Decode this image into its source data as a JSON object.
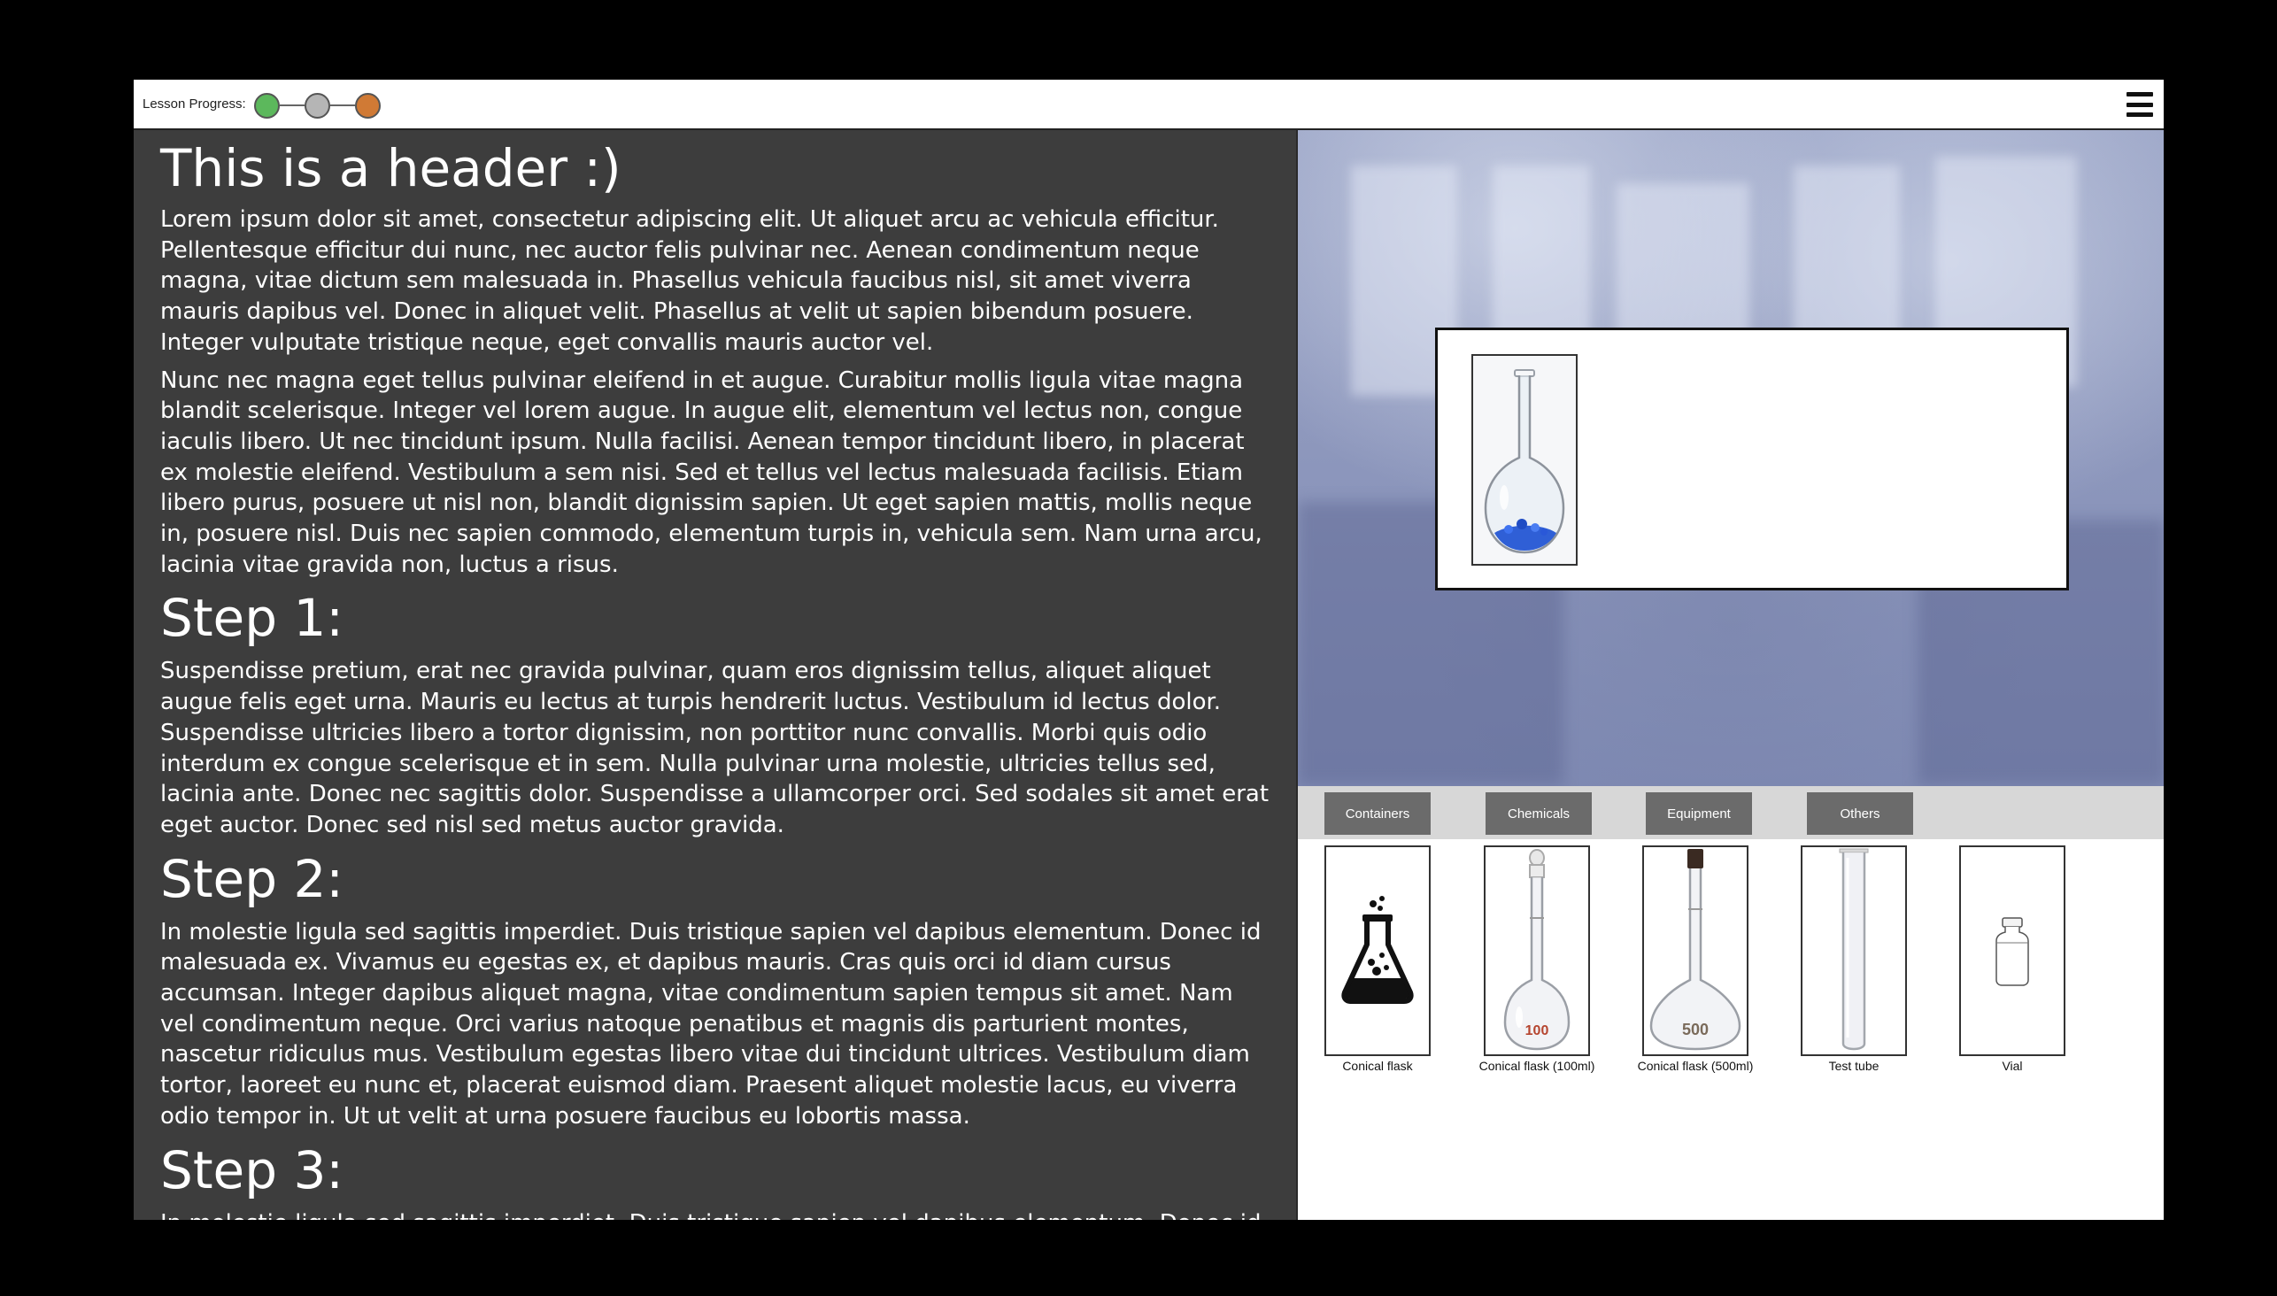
{
  "topbar": {
    "progress_label": "Lesson Progress:",
    "progress_steps": [
      {
        "state": "complete",
        "color": "#5cb85c"
      },
      {
        "state": "pending",
        "color": "#b5b5b5"
      },
      {
        "state": "current",
        "color": "#d07a35"
      }
    ],
    "menu_icon": "hamburger-menu-icon"
  },
  "content": {
    "header": "This is a header :)",
    "intro_p1": "Lorem ipsum dolor sit amet, consectetur adipiscing elit. Ut aliquet arcu ac vehicula efficitur. Pellentesque efficitur dui nunc, nec auctor felis pulvinar nec. Aenean condimentum neque magna, vitae dictum sem malesuada in. Phasellus vehicula faucibus nisl, sit amet viverra mauris dapibus vel. Donec in aliquet velit. Phasellus at velit ut sapien bibendum posuere. Integer vulputate tristique neque, eget convallis mauris auctor vel.",
    "intro_p2": "Nunc nec magna eget tellus pulvinar eleifend in et augue. Curabitur mollis ligula vitae magna blandit scelerisque. Integer vel lorem augue. In augue elit, elementum vel lectus non, congue iaculis libero. Ut nec tincidunt ipsum. Nulla facilisi. Aenean tempor tincidunt libero, in placerat ex molestie eleifend. Vestibulum a sem nisi. Sed et tellus vel lectus malesuada facilisis. Etiam libero purus, posuere ut nisl non, blandit dignissim sapien. Ut eget sapien mattis, mollis neque in, posuere nisl. Duis nec sapien commodo, elementum turpis in, vehicula sem. Nam urna arcu, lacinia vitae gravida non, luctus a risus.",
    "step1_title": "Step 1:",
    "step1_text": "Suspendisse pretium, erat nec gravida pulvinar, quam eros dignissim tellus, aliquet aliquet augue felis eget urna. Mauris eu lectus at turpis hendrerit luctus. Vestibulum id lectus dolor. Suspendisse ultricies libero a tortor dignissim, non porttitor nunc convallis. Morbi quis odio interdum ex congue scelerisque et in sem. Nulla pulvinar urna molestie, ultricies tellus sed, lacinia ante. Donec nec sagittis dolor. Suspendisse a ullamcorper orci. Sed sodales sit amet erat eget auctor. Donec sed nisl sed metus auctor gravida.",
    "step2_title": "Step 2:",
    "step2_text": "In molestie ligula sed sagittis imperdiet. Duis tristique sapien vel dapibus elementum. Donec id malesuada ex. Vivamus eu egestas ex, et dapibus mauris. Cras quis orci id diam cursus accumsan. Integer dapibus aliquet magna, vitae condimentum sapien tempus sit amet. Nam vel condimentum neque. Orci varius natoque penatibus et magnis dis parturient montes, nascetur ridiculus mus. Vestibulum egestas libero vitae dui tincidunt ultrices. Vestibulum diam tortor, laoreet eu nunc et, placerat euismod diam. Praesent aliquet molestie lacus, eu viverra odio tempor in. Ut ut velit at urna posuere faucibus eu lobortis massa.",
    "step3_title": "Step 3:",
    "step3_text": "In molestie ligula sed sagittis imperdiet. Duis tristique sapien vel dapibus elementum. Donec id malesuada ex."
  },
  "workbench": {
    "items": [
      {
        "icon": "round-flask-with-blue-crystals"
      }
    ]
  },
  "tabs": [
    "Containers",
    "Chemicals",
    "Equipment",
    "Others"
  ],
  "items": [
    {
      "label": "Conical flask",
      "icon": "conical-flask-icon"
    },
    {
      "label": "Conical flask (100ml)",
      "icon": "volumetric-flask-100ml-icon",
      "mark": "100"
    },
    {
      "label": "Conical flask (500ml)",
      "icon": "volumetric-flask-500ml-icon",
      "mark": "500"
    },
    {
      "label": "Test tube",
      "icon": "test-tube-icon"
    },
    {
      "label": "Vial",
      "icon": "vial-icon"
    }
  ]
}
